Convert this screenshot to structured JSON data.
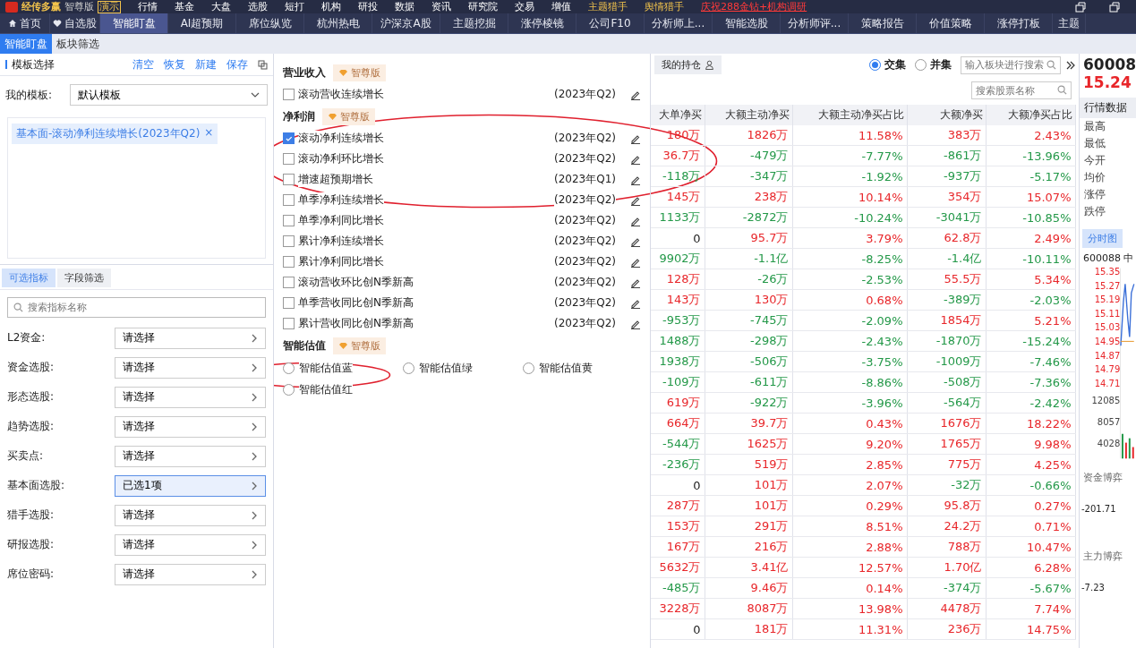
{
  "brand": {
    "name": "经传多赢",
    "edition": "智尊版",
    "mode": "演示"
  },
  "top_menu": [
    "行情",
    "基金",
    "大盘",
    "选股",
    "短打",
    "机构",
    "研投",
    "数据",
    "资讯",
    "研究院",
    "交易",
    "增值"
  ],
  "top_menu_special": [
    "主题猎手",
    "舆情猎手"
  ],
  "promo": "庆祝288金钻+机构调研",
  "nav_tabs": [
    {
      "label": "首页",
      "kind": "home",
      "selected": false
    },
    {
      "label": "自选股",
      "kind": "favorite",
      "selected": false
    },
    {
      "label": "智能盯盘",
      "kind": "plain",
      "selected": true
    },
    {
      "label": "AI超预期",
      "kind": "plain",
      "selected": false
    },
    {
      "label": "席位纵览",
      "kind": "plain",
      "selected": false
    },
    {
      "label": "杭州热电",
      "kind": "plain",
      "selected": false
    },
    {
      "label": "沪深京A股",
      "kind": "plain",
      "selected": false
    },
    {
      "label": "主题挖掘",
      "kind": "plain",
      "selected": false
    },
    {
      "label": "涨停棱镜",
      "kind": "plain",
      "selected": false
    },
    {
      "label": "公司F10",
      "kind": "plain",
      "selected": false
    },
    {
      "label": "分析师上...",
      "kind": "plain",
      "selected": false
    },
    {
      "label": "智能选股",
      "kind": "plain",
      "selected": false
    },
    {
      "label": "分析师评...",
      "kind": "plain",
      "selected": false
    },
    {
      "label": "策略报告",
      "kind": "plain",
      "selected": false
    },
    {
      "label": "价值策略",
      "kind": "plain",
      "selected": false
    },
    {
      "label": "涨停打板",
      "kind": "plain",
      "selected": false
    },
    {
      "label": "主题",
      "kind": "plain",
      "selected": false
    }
  ],
  "sub_tabs": [
    {
      "label": "智能盯盘",
      "selected": true
    },
    {
      "label": "板块筛选",
      "selected": false
    }
  ],
  "left": {
    "title": "模板选择",
    "actions": [
      "清空",
      "恢复",
      "新建",
      "保存"
    ],
    "template_label": "我的模板:",
    "template_value": "默认模板",
    "tags": [
      {
        "label": "基本面-滚动净利连续增长(2023年Q2)",
        "remove": "×"
      }
    ],
    "tabs": [
      {
        "label": "可选指标",
        "selected": true
      },
      {
        "label": "字段筛选",
        "selected": false
      }
    ],
    "search": {
      "placeholder": "搜索指标名称"
    },
    "filters": [
      {
        "label": "L2资金:",
        "value": "请选择",
        "selected": false
      },
      {
        "label": "资金选股:",
        "value": "请选择",
        "selected": false
      },
      {
        "label": "形态选股:",
        "value": "请选择",
        "selected": false
      },
      {
        "label": "趋势选股:",
        "value": "请选择",
        "selected": false
      },
      {
        "label": "买卖点:",
        "value": "请选择",
        "selected": false
      },
      {
        "label": "基本面选股:",
        "value": "已选1项",
        "selected": true
      },
      {
        "label": "猎手选股:",
        "value": "请选择",
        "selected": false
      },
      {
        "label": "研报选股:",
        "value": "请选择",
        "selected": false
      },
      {
        "label": "席位密码:",
        "value": "请选择",
        "selected": false
      }
    ]
  },
  "sections": [
    {
      "title": "营业收入",
      "badge": "智尊版",
      "kind": "checkbox",
      "items": [
        {
          "label": "滚动营收连续增长",
          "period": "(2023年Q2)",
          "checked": false
        }
      ]
    },
    {
      "title": "净利润",
      "badge": "智尊版",
      "kind": "checkbox",
      "items": [
        {
          "label": "滚动净利连续增长",
          "period": "(2023年Q2)",
          "checked": true
        },
        {
          "label": "滚动净利环比增长",
          "period": "(2023年Q2)",
          "checked": false
        },
        {
          "label": "增速超预期增长",
          "period": "(2023年Q1)",
          "checked": false
        },
        {
          "label": "单季净利连续增长",
          "period": "(2023年Q2)",
          "checked": false
        },
        {
          "label": "单季净利同比增长",
          "period": "(2023年Q2)",
          "checked": false
        },
        {
          "label": "累计净利连续增长",
          "period": "(2023年Q2)",
          "checked": false
        },
        {
          "label": "累计净利同比增长",
          "period": "(2023年Q2)",
          "checked": false
        },
        {
          "label": "滚动营收环比创N季新高",
          "period": "(2023年Q2)",
          "checked": false
        },
        {
          "label": "单季营收同比创N季新高",
          "period": "(2023年Q2)",
          "checked": false
        },
        {
          "label": "累计营收同比创N季新高",
          "period": "(2023年Q2)",
          "checked": false
        }
      ]
    },
    {
      "title": "智能估值",
      "badge": "智尊版",
      "kind": "radio",
      "items": [
        {
          "label": "智能估值蓝",
          "selected": false
        },
        {
          "label": "智能估值绿",
          "selected": false
        },
        {
          "label": "智能估值黄",
          "selected": false
        },
        {
          "label": "智能估值红",
          "selected": false
        }
      ]
    }
  ],
  "annotations": [
    {
      "kind": "ellipse"
    },
    {
      "kind": "ellipse"
    }
  ],
  "table": {
    "holdings": "我的持仓",
    "modes": [
      {
        "label": "交集",
        "selected": true
      },
      {
        "label": "并集",
        "selected": false
      }
    ],
    "sector_search": {
      "placeholder": "输入板块进行搜索"
    },
    "stock_search": {
      "placeholder": "搜索股票名称"
    },
    "columns": [
      "大单净买",
      "大额主动净买",
      "大额主动净买占比",
      "大额净买",
      "大额净买占比"
    ],
    "rows": [
      [
        {
          "v": "180万",
          "color": "#e8262a"
        },
        {
          "v": "1826万",
          "color": "#e8262a"
        },
        {
          "v": "11.58%",
          "color": "#e8262a"
        },
        {
          "v": "383万",
          "color": "#e8262a"
        },
        {
          "v": "2.43%",
          "color": "#e8262a"
        }
      ],
      [
        {
          "v": "36.7万",
          "color": "#e8262a"
        },
        {
          "v": "-479万",
          "color": "#239848"
        },
        {
          "v": "-7.77%",
          "color": "#239848"
        },
        {
          "v": "-861万",
          "color": "#239848"
        },
        {
          "v": "-13.96%",
          "color": "#239848"
        }
      ],
      [
        {
          "v": "-118万",
          "color": "#239848"
        },
        {
          "v": "-347万",
          "color": "#239848"
        },
        {
          "v": "-1.92%",
          "color": "#239848"
        },
        {
          "v": "-937万",
          "color": "#239848"
        },
        {
          "v": "-5.17%",
          "color": "#239848"
        }
      ],
      [
        {
          "v": "145万",
          "color": "#e8262a"
        },
        {
          "v": "238万",
          "color": "#e8262a"
        },
        {
          "v": "10.14%",
          "color": "#e8262a"
        },
        {
          "v": "354万",
          "color": "#e8262a"
        },
        {
          "v": "15.07%",
          "color": "#e8262a"
        }
      ],
      [
        {
          "v": "1133万",
          "color": "#239848"
        },
        {
          "v": "-2872万",
          "color": "#239848"
        },
        {
          "v": "-10.24%",
          "color": "#239848"
        },
        {
          "v": "-3041万",
          "color": "#239848"
        },
        {
          "v": "-10.85%",
          "color": "#239848"
        }
      ],
      [
        {
          "v": "0",
          "color": "#222222"
        },
        {
          "v": "95.7万",
          "color": "#e8262a"
        },
        {
          "v": "3.79%",
          "color": "#e8262a"
        },
        {
          "v": "62.8万",
          "color": "#e8262a"
        },
        {
          "v": "2.49%",
          "color": "#e8262a"
        }
      ],
      [
        {
          "v": "9902万",
          "color": "#239848"
        },
        {
          "v": "-1.1亿",
          "color": "#239848"
        },
        {
          "v": "-8.25%",
          "color": "#239848"
        },
        {
          "v": "-1.4亿",
          "color": "#239848"
        },
        {
          "v": "-10.11%",
          "color": "#239848"
        }
      ],
      [
        {
          "v": "128万",
          "color": "#e8262a"
        },
        {
          "v": "-26万",
          "color": "#239848"
        },
        {
          "v": "-2.53%",
          "color": "#239848"
        },
        {
          "v": "55.5万",
          "color": "#e8262a"
        },
        {
          "v": "5.34%",
          "color": "#e8262a"
        }
      ],
      [
        {
          "v": "143万",
          "color": "#e8262a"
        },
        {
          "v": "130万",
          "color": "#e8262a"
        },
        {
          "v": "0.68%",
          "color": "#e8262a"
        },
        {
          "v": "-389万",
          "color": "#239848"
        },
        {
          "v": "-2.03%",
          "color": "#239848"
        }
      ],
      [
        {
          "v": "-953万",
          "color": "#239848"
        },
        {
          "v": "-745万",
          "color": "#239848"
        },
        {
          "v": "-2.09%",
          "color": "#239848"
        },
        {
          "v": "1854万",
          "color": "#e8262a"
        },
        {
          "v": "5.21%",
          "color": "#e8262a"
        }
      ],
      [
        {
          "v": "1488万",
          "color": "#239848"
        },
        {
          "v": "-298万",
          "color": "#239848"
        },
        {
          "v": "-2.43%",
          "color": "#239848"
        },
        {
          "v": "-1870万",
          "color": "#239848"
        },
        {
          "v": "-15.24%",
          "color": "#239848"
        }
      ],
      [
        {
          "v": "1938万",
          "color": "#239848"
        },
        {
          "v": "-506万",
          "color": "#239848"
        },
        {
          "v": "-3.75%",
          "color": "#239848"
        },
        {
          "v": "-1009万",
          "color": "#239848"
        },
        {
          "v": "-7.46%",
          "color": "#239848"
        }
      ],
      [
        {
          "v": "-109万",
          "color": "#239848"
        },
        {
          "v": "-611万",
          "color": "#239848"
        },
        {
          "v": "-8.86%",
          "color": "#239848"
        },
        {
          "v": "-508万",
          "color": "#239848"
        },
        {
          "v": "-7.36%",
          "color": "#239848"
        }
      ],
      [
        {
          "v": "619万",
          "color": "#e8262a"
        },
        {
          "v": "-922万",
          "color": "#239848"
        },
        {
          "v": "-3.96%",
          "color": "#239848"
        },
        {
          "v": "-564万",
          "color": "#239848"
        },
        {
          "v": "-2.42%",
          "color": "#239848"
        }
      ],
      [
        {
          "v": "664万",
          "color": "#e8262a"
        },
        {
          "v": "39.7万",
          "color": "#e8262a"
        },
        {
          "v": "0.43%",
          "color": "#e8262a"
        },
        {
          "v": "1676万",
          "color": "#e8262a"
        },
        {
          "v": "18.22%",
          "color": "#e8262a"
        }
      ],
      [
        {
          "v": "-544万",
          "color": "#239848"
        },
        {
          "v": "1625万",
          "color": "#e8262a"
        },
        {
          "v": "9.20%",
          "color": "#e8262a"
        },
        {
          "v": "1765万",
          "color": "#e8262a"
        },
        {
          "v": "9.98%",
          "color": "#e8262a"
        }
      ],
      [
        {
          "v": "-236万",
          "color": "#239848"
        },
        {
          "v": "519万",
          "color": "#e8262a"
        },
        {
          "v": "2.85%",
          "color": "#e8262a"
        },
        {
          "v": "775万",
          "color": "#e8262a"
        },
        {
          "v": "4.25%",
          "color": "#e8262a"
        }
      ],
      [
        {
          "v": "0",
          "color": "#222222"
        },
        {
          "v": "101万",
          "color": "#e8262a"
        },
        {
          "v": "2.07%",
          "color": "#e8262a"
        },
        {
          "v": "-32万",
          "color": "#239848"
        },
        {
          "v": "-0.66%",
          "color": "#239848"
        }
      ],
      [
        {
          "v": "287万",
          "color": "#e8262a"
        },
        {
          "v": "101万",
          "color": "#e8262a"
        },
        {
          "v": "0.29%",
          "color": "#e8262a"
        },
        {
          "v": "95.8万",
          "color": "#e8262a"
        },
        {
          "v": "0.27%",
          "color": "#e8262a"
        }
      ],
      [
        {
          "v": "153万",
          "color": "#e8262a"
        },
        {
          "v": "291万",
          "color": "#e8262a"
        },
        {
          "v": "8.51%",
          "color": "#e8262a"
        },
        {
          "v": "24.2万",
          "color": "#e8262a"
        },
        {
          "v": "0.71%",
          "color": "#e8262a"
        }
      ],
      [
        {
          "v": "167万",
          "color": "#e8262a"
        },
        {
          "v": "216万",
          "color": "#e8262a"
        },
        {
          "v": "2.88%",
          "color": "#e8262a"
        },
        {
          "v": "788万",
          "color": "#e8262a"
        },
        {
          "v": "10.47%",
          "color": "#e8262a"
        }
      ],
      [
        {
          "v": "5632万",
          "color": "#e8262a"
        },
        {
          "v": "3.41亿",
          "color": "#e8262a"
        },
        {
          "v": "12.57%",
          "color": "#e8262a"
        },
        {
          "v": "1.70亿",
          "color": "#e8262a"
        },
        {
          "v": "6.28%",
          "color": "#e8262a"
        }
      ],
      [
        {
          "v": "-485万",
          "color": "#239848"
        },
        {
          "v": "9.46万",
          "color": "#e8262a"
        },
        {
          "v": "0.14%",
          "color": "#e8262a"
        },
        {
          "v": "-374万",
          "color": "#239848"
        },
        {
          "v": "-5.67%",
          "color": "#239848"
        }
      ],
      [
        {
          "v": "3228万",
          "color": "#e8262a"
        },
        {
          "v": "8087万",
          "color": "#e8262a"
        },
        {
          "v": "13.98%",
          "color": "#e8262a"
        },
        {
          "v": "4478万",
          "color": "#e8262a"
        },
        {
          "v": "7.74%",
          "color": "#e8262a"
        }
      ],
      [
        {
          "v": "0",
          "color": "#222222"
        },
        {
          "v": "181万",
          "color": "#e8262a"
        },
        {
          "v": "11.31%",
          "color": "#e8262a"
        },
        {
          "v": "236万",
          "color": "#e8262a"
        },
        {
          "v": "14.75%",
          "color": "#e8262a"
        }
      ]
    ]
  },
  "quote": {
    "code": "60008",
    "price": "15.24",
    "section": "行情数据",
    "fields": [
      "最高",
      "最低",
      "今开",
      "均价",
      "涨停",
      "跌停"
    ],
    "chart_tab": "分时图",
    "chart_title": "600088 中",
    "price_ticks": [
      "15.35",
      "15.27",
      "15.19",
      "15.11",
      "15.03",
      "14.95",
      "14.87",
      "14.79",
      "14.71"
    ],
    "volume_ticks": [
      "12085",
      "8057",
      "4028"
    ],
    "fund_title": "资金博弈",
    "fund_value": "-201.71",
    "main_title": "主力博弈",
    "main_value": "-7.23"
  }
}
